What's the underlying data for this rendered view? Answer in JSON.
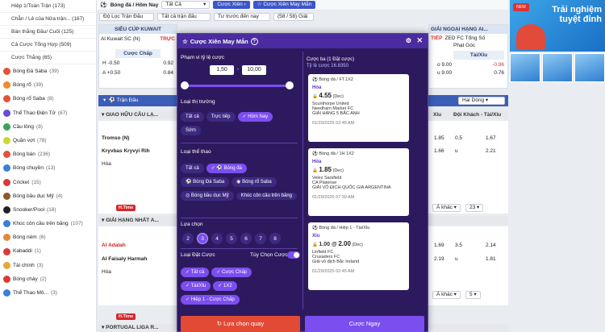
{
  "sidebar": {
    "top_items": [
      "Hiệp 1/Toàn Trận (173)",
      "Chẵn / Lẻ của Nửa trận... (167)",
      "Bàn thắng Đầu/ Cuối (125)",
      "Cả Cược Tổng Hợp (509)",
      "Cược Thắng (65)"
    ],
    "sports": [
      {
        "label": "Bóng Đá Saba",
        "count": "(39)",
        "color": "#e2533a"
      },
      {
        "label": "Bóng rổ",
        "count": "(39)",
        "color": "#f08a24"
      },
      {
        "label": "Bóng rổ Saba",
        "count": "(8)",
        "color": "#e2533a"
      },
      {
        "label": "Thể Thao Điện Tử",
        "count": "(67)",
        "color": "#6a4bd3"
      },
      {
        "label": "Cầu lông",
        "count": "(8)",
        "color": "#3aa35a"
      },
      {
        "label": "Quần vợt",
        "count": "(78)",
        "color": "#c9d832"
      },
      {
        "label": "Bóng bàn",
        "count": "(236)",
        "color": "#e2533a"
      },
      {
        "label": "Bóng chuyền",
        "count": "(13)",
        "color": "#3a7fd8"
      },
      {
        "label": "Cricket",
        "count": "(15)",
        "color": "#d83a3a"
      },
      {
        "label": "Bóng bầu dục Mỹ",
        "count": "(4)",
        "color": "#8a5a2b"
      },
      {
        "label": "Snooker/Pool",
        "count": "(18)",
        "color": "#222222"
      },
      {
        "label": "Khúc côn cầu trên băng",
        "count": "(107)",
        "color": "#3a7fd8"
      },
      {
        "label": "Bóng ném",
        "count": "(6)",
        "color": "#e28a3a"
      },
      {
        "label": "Kabaddi",
        "count": "(1)",
        "color": "#d83a3a"
      },
      {
        "label": "Tài chính",
        "count": "(3)",
        "color": "#e2a83a"
      },
      {
        "label": "Bóng chày",
        "count": "(2)",
        "color": "#d83a3a"
      },
      {
        "label": "Thể Thao Mô...",
        "count": "(3)",
        "color": "#3a7fd8"
      }
    ]
  },
  "topbar": {
    "breadcrumb": "Bóng đá / Hôm Nay",
    "filter_select": "Tất Cả",
    "btn_parlay": "Cược Xiên",
    "btn_lucky": "Cược Xiên May Mắn",
    "filter1": "Độ Lọc Trận Đấu",
    "filter2": "Tất cả trận đấu",
    "filter3": "Tư trước đến nay",
    "filter4": "(58 / 58) Giải"
  },
  "banner": {
    "line1": "Trải nghiệm",
    "line2": "tuyệt đỉnh"
  },
  "bg_tables": {
    "t1_title": "SIÊU CÚP KUWAIT",
    "t1_team": "Al Kuwait SC (N)",
    "t1_live": "TRỰC",
    "t2_title": "GIẢI NGOẠI HẠNG AI...",
    "t3_title": "GIẢI NGOẠI HẠNG AI...",
    "t3_live": "TIẾP",
    "t3_team": "ZED FC Tổng Số",
    "t3_sub": "Phạt Góc",
    "col_handicap": "Cược Chấp",
    "col_ou": "Tài/Xỉu",
    "h1": "H -0.50",
    "h1v": "0.92",
    "h2": "A +0.50",
    "h2v": "0.84",
    "o1": "o 9.00",
    "o1v": "-0.96",
    "u1": "u 9.00",
    "u1v": "0.76",
    "match_header": "Trận Đấu",
    "sort_label": "Hai Dòng",
    "league1": "GIAO HỮU CÂU LẠ...",
    "col_xiu": "Xỉu",
    "col_away": "Đội Khách - Tài/Xỉu",
    "team_a": "Tromso (N)",
    "team_b": "Kryvbas Kryvyi Rih",
    "draw": "Hòa",
    "r1c1": "1.85",
    "r1c2": "0.5",
    "r1c3": "1.67",
    "r2c1": "1.66",
    "r2c2": "u",
    "r2c3": "2.21",
    "htime": "H.Time",
    "more1": "Á khác",
    "more1_count": "23",
    "league2": "GIẢI HẠNG NHẤT A...",
    "team_c": "Al Adalah",
    "team_d": "Al Faisaly Harmah",
    "r3c1": "1.69",
    "r3c2": "3.5",
    "r3c3": "2.14",
    "r4c1": "2.19",
    "r4c2": "u",
    "r4c3": "1.81",
    "more2": "Á khác",
    "more2_count": "5",
    "league3": "PORTUGAL LIGA R..."
  },
  "modal": {
    "title": "Cược Xiên May Mắn",
    "odds_range_label": "Phạm vi tỷ lệ cược",
    "odds_min": "1,50",
    "odds_max": "10,00",
    "market_label": "Loại thị trường",
    "markets": [
      "Tất cả",
      "Trực tiếp",
      "Hôm Nay",
      "Sớm"
    ],
    "sport_label": "Loại thể thao",
    "sports": [
      "Tất cả",
      "Bóng đá",
      "Bóng Đá Saba",
      "Bóng rổ Saba",
      "Bóng bầu dục Mỹ",
      "Khúc côn cầu trên băng"
    ],
    "selection_label": "Lựa chọn",
    "selections": [
      "2",
      "3",
      "4",
      "5",
      "6",
      "7",
      "8"
    ],
    "bettype_label": "Loại Đặt Cược",
    "optional_label": "Tùy Chọn Cược",
    "bettypes": [
      "Tất cả",
      "Cược Chấp",
      "Tài/Xỉu",
      "1X2",
      "Hiệp 1 - Cược Chấp"
    ],
    "right_title": "Cược ba (1 Đặt cược)",
    "right_odds": "Tỷ lệ cược 16.8350",
    "tickets": [
      {
        "sport": "Bóng đá / FT.1X2",
        "pick": "Hòa",
        "odds": "4.55",
        "dec": "(Dec)",
        "team1": "Scunthorpe United",
        "team2": "Needham Market FC",
        "league": "GIẢI HẠNG 5 BẮC ANH",
        "time": "01/29/2025 02:45 AM"
      },
      {
        "sport": "Bóng đá / 1H 1X2",
        "pick": "Hòa",
        "odds": "1.85",
        "dec": "(Dec)",
        "team1": "Velez Sarsfield",
        "team2": "CA Platense",
        "league": "GIẢI VÔ ĐỊCH QUỐC GIA ARGENTINA",
        "time": "01/29/2025 07:30 AM"
      },
      {
        "sport": "Bóng đá / Hiệp 1 - Tài/Xỉu",
        "pick": "Xỉu",
        "line": "1.00 @",
        "odds": "2.00",
        "dec": "(Dec)",
        "team1": "Linfield FC",
        "team2": "Crusaders FC",
        "league": "Giải vô địch Bắc Ireland",
        "time": "01/29/2025 02:45 AM"
      }
    ],
    "btn_reset": "Lựa chọn quay",
    "btn_bet": "Cược Ngay"
  }
}
